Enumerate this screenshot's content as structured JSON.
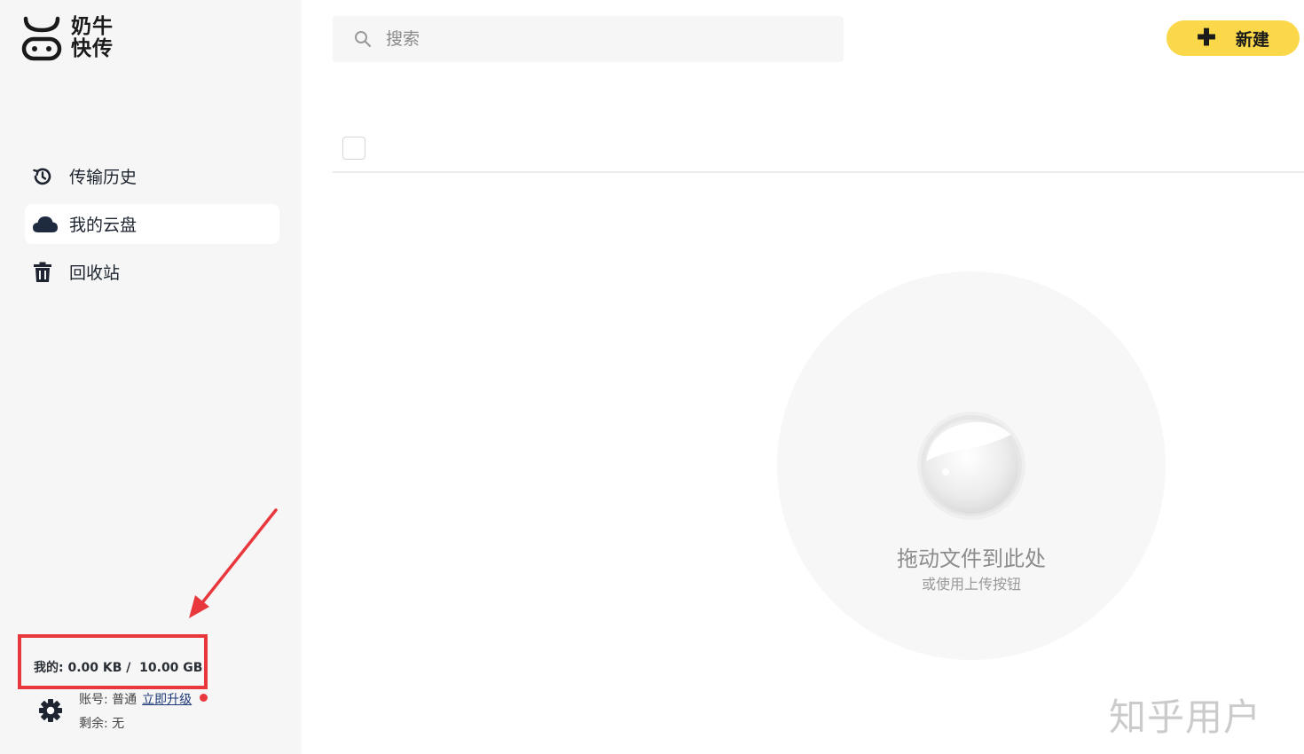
{
  "brand": {
    "name_line1": "奶牛",
    "name_line2": "快传"
  },
  "nav": {
    "items": [
      {
        "label": "传输历史",
        "icon": "history-icon"
      },
      {
        "label": "我的云盘",
        "icon": "cloud-icon",
        "active": true
      },
      {
        "label": "回收站",
        "icon": "trash-icon"
      }
    ]
  },
  "storage": {
    "text": "我的: 0.00 KB /  10.00 GB"
  },
  "account": {
    "type_label": "账号: 普通",
    "upgrade_label": "立即升级",
    "remaining_label": "剩余: 无"
  },
  "search": {
    "placeholder": "搜索",
    "value": ""
  },
  "toolbar": {
    "new_label": "新建"
  },
  "dropzone": {
    "title": "拖动文件到此处",
    "subtitle": "或使用上传按钮"
  },
  "watermark": "知乎用户",
  "colors": {
    "accent": "#fbd84a",
    "annotation": "#e8383d",
    "sidebar_bg": "#f6f6f6"
  }
}
